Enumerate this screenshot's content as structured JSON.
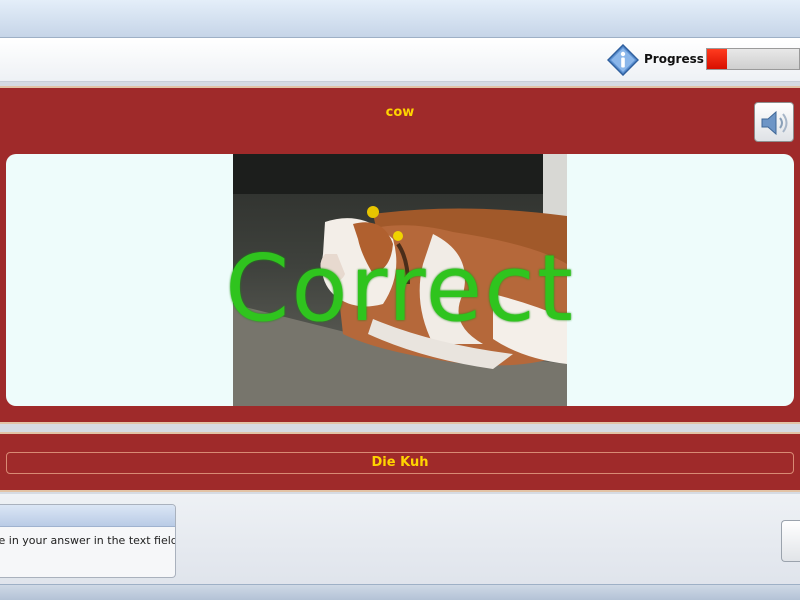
{
  "toolbar": {
    "progress_label": "Progress",
    "progress_value": 0.22,
    "info_icon": "info-icon"
  },
  "card": {
    "word": "cow",
    "speaker_icon": "speaker-icon",
    "feedback": "Correct"
  },
  "answer": {
    "value": "Die Kuh"
  },
  "footer": {
    "hint_text": "Type in your answer in the text field."
  },
  "colors": {
    "card_red": "#9f2a2a",
    "label_yellow": "#ffd400",
    "correct_green": "#2fc41e",
    "progress_red": "#e81f00"
  }
}
